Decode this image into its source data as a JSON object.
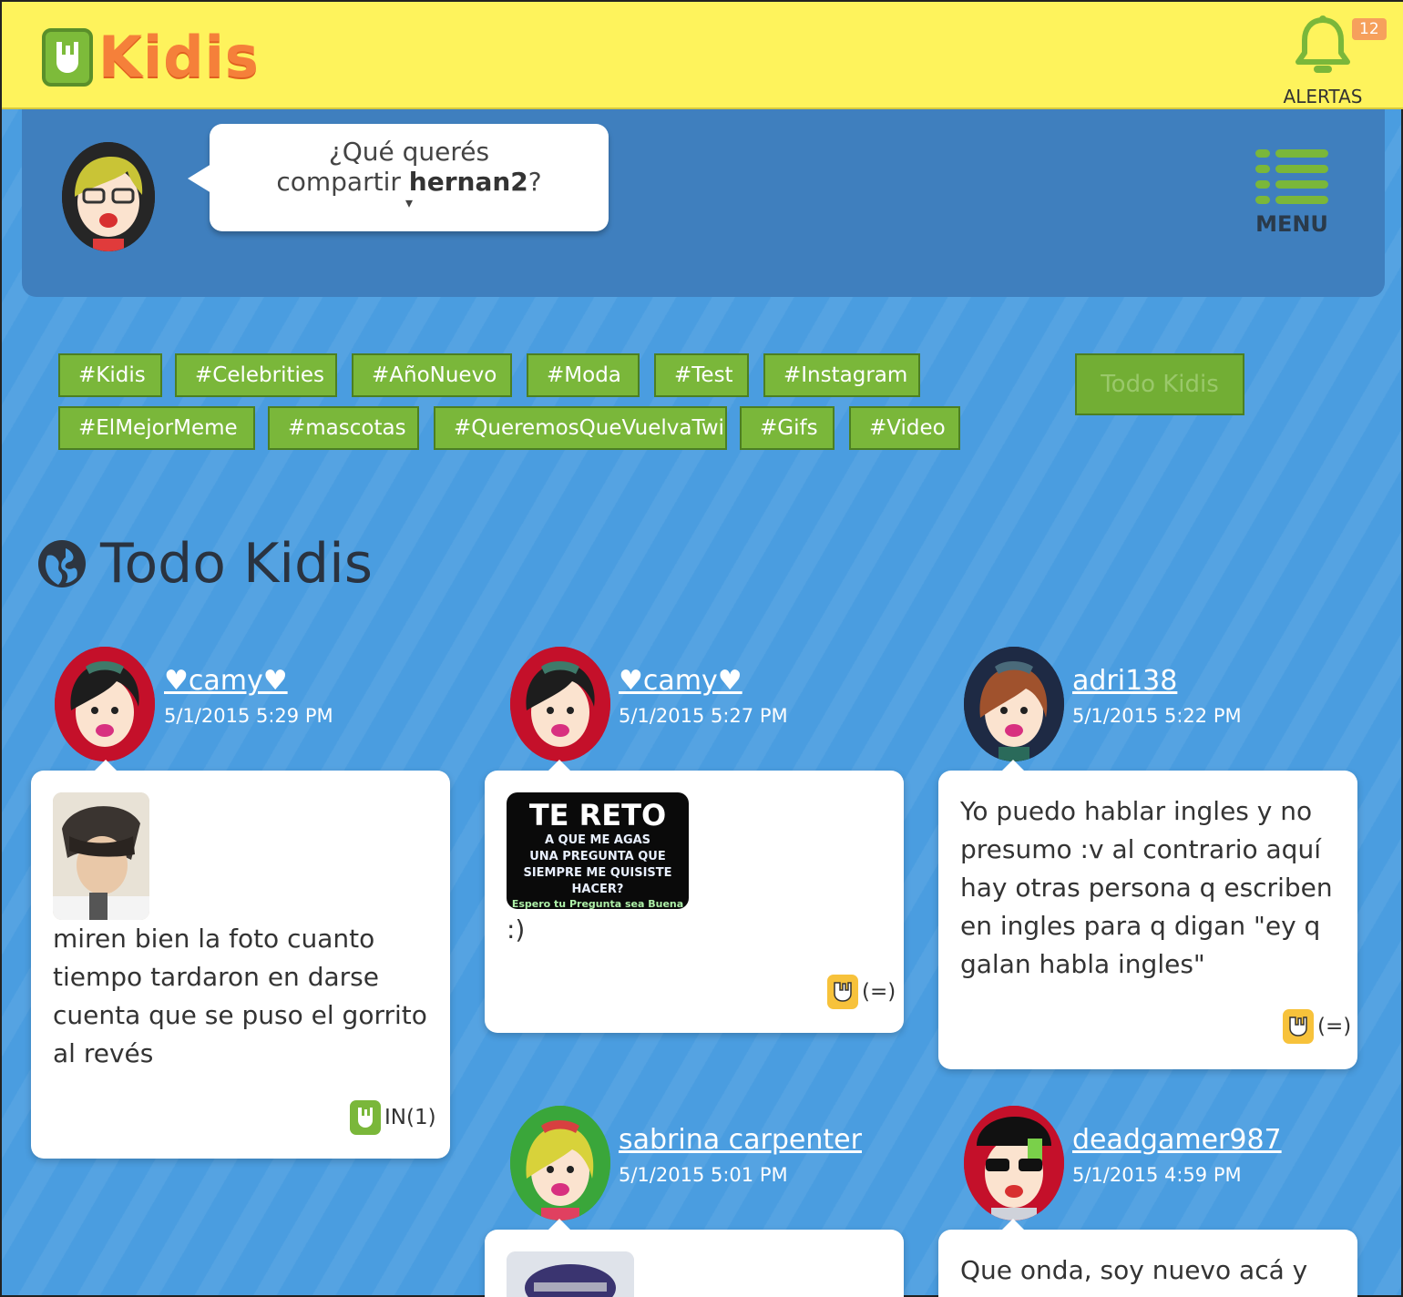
{
  "app": {
    "logo_text": "Kidis",
    "logo_mark": "hand-rock-logo"
  },
  "alerts": {
    "label": "ALERTAS",
    "count": "12",
    "icon": "bell-icon"
  },
  "compose": {
    "prompt_line1": "¿Qué querés",
    "prompt_prefix": "compartir ",
    "username": "hernan2",
    "prompt_suffix": "?",
    "caret": "▾"
  },
  "menu": {
    "label": "MENU",
    "icon": "hamburger-menu-icon"
  },
  "hashtags": [
    "#Kidis",
    "#Celebrities",
    "#AñoNuevo",
    "#Moda",
    "#Test",
    "#Instagram",
    "#ElMejorMeme",
    "#mascotas",
    "#QueremosQueVuelvaTwig",
    "#Gifs",
    "#Video"
  ],
  "filter_button": "Todo Kidis",
  "section": {
    "title": "Todo Kidis",
    "icon": "globe-icon"
  },
  "posts": [
    {
      "user": "♥camy♥",
      "date": "5/1/2015 5:29 PM",
      "text": "miren bien la foto cuanto tiempo tardaron en darse cuenta que se puso el gorrito al revés",
      "reaction": "IN(1)"
    },
    {
      "user": "♥camy♥",
      "date": "5/1/2015 5:27 PM",
      "text": ":)",
      "reaction": "(=)",
      "image_text": {
        "title": "TE RETO",
        "line1": "A QUE ME AGAS",
        "line2": "UNA PREGUNTA QUE",
        "line3": "SIEMPRE ME QUISISTE",
        "line4": "HACER?",
        "line5": "Espero tu Pregunta sea Buena"
      }
    },
    {
      "user": "adri138",
      "date": "5/1/2015 5:22 PM",
      "text": "Yo puedo hablar ingles y no presumo :v al contrario aquí hay otras persona q escriben en ingles para q digan \"ey q galan habla ingles\"",
      "reaction": "(=)"
    },
    {
      "user": "sabrina carpenter",
      "date": "5/1/2015 5:01 PM"
    },
    {
      "user": "deadgamer987",
      "date": "5/1/2015 4:59 PM",
      "text": "Que onda, soy nuevo acá y"
    }
  ],
  "colors": {
    "topbar": "#fef35c",
    "accent_green": "#7ab73a",
    "logo_orange": "#f5803a",
    "background_blue": "#4a9de0"
  }
}
